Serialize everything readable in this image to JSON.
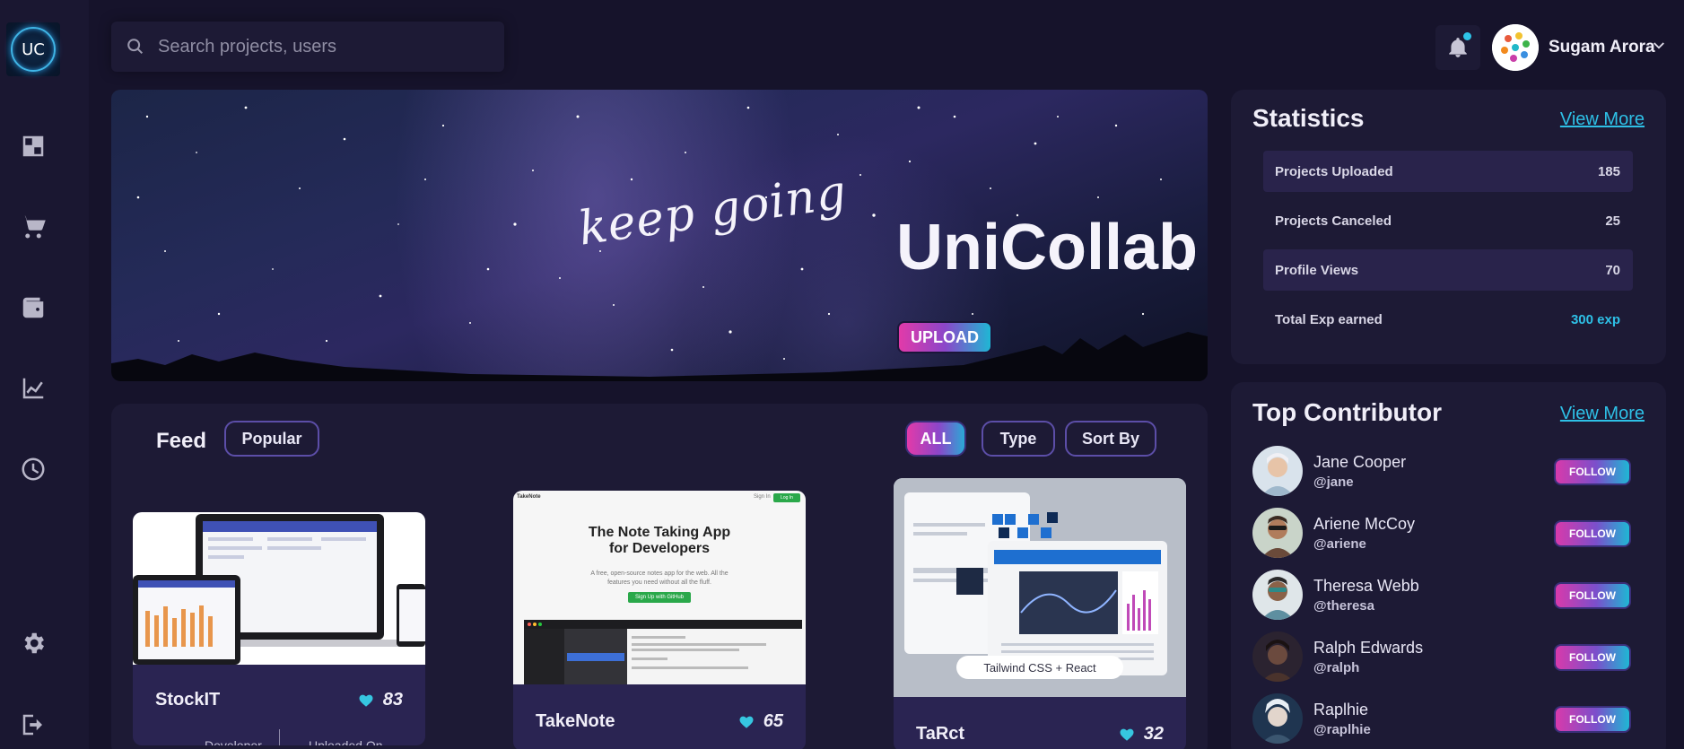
{
  "app": {
    "logo_text": "UC"
  },
  "sidebar": {
    "items": [
      {
        "icon": "dashboard-icon"
      },
      {
        "icon": "cart-icon"
      },
      {
        "icon": "wallet-icon"
      },
      {
        "icon": "chart-icon"
      },
      {
        "icon": "clock-icon"
      },
      {
        "icon": "gear-icon"
      },
      {
        "icon": "logout-icon"
      }
    ]
  },
  "search": {
    "placeholder": "Search projects, users",
    "value": ""
  },
  "user": {
    "name": "Sugam Arora"
  },
  "banner": {
    "tagline": "keep going",
    "brand": "UniCollab",
    "upload_label": "UPLOAD"
  },
  "feed": {
    "title": "Feed",
    "popular_label": "Popular",
    "filters": {
      "all": "ALL",
      "type": "Type",
      "sort": "Sort By"
    },
    "cards": [
      {
        "title": "StockIT",
        "likes": "83",
        "meta_left": "Developer",
        "meta_right": "Uploaded On"
      },
      {
        "title": "TakeNote",
        "likes": "65",
        "preview_brand": "TakeNote",
        "preview_heading_1": "The Note Taking App",
        "preview_heading_2": "for Developers",
        "preview_sub": "A free, open-source notes app for the web. All the features you need without all the fluff.",
        "preview_button": "Sign Up with GitHub",
        "preview_signin": "Sign In",
        "preview_login": "Log In"
      },
      {
        "title": "TaRct",
        "likes": "32",
        "preview_badge": "Tailwind CSS + React"
      }
    ]
  },
  "statistics": {
    "title": "Statistics",
    "view_more": "View More",
    "rows": [
      {
        "label": "Projects Uploaded",
        "value": "185"
      },
      {
        "label": "Projects Canceled",
        "value": "25"
      },
      {
        "label": "Profile Views",
        "value": "70"
      },
      {
        "label": "Total Exp earned",
        "value": "300 exp"
      }
    ]
  },
  "contributors": {
    "title": "Top Contributor",
    "view_more": "View More",
    "follow_label": "FOLLOW",
    "people": [
      {
        "name": "Jane Cooper",
        "handle": "@jane",
        "color": "#c9d6e3"
      },
      {
        "name": "Ariene McCoy",
        "handle": "@ariene",
        "color": "#7a5a48"
      },
      {
        "name": "Theresa Webb",
        "handle": "@theresa",
        "color": "#5e8fa0"
      },
      {
        "name": "Ralph Edwards",
        "handle": "@ralph",
        "color": "#6b4a3e"
      },
      {
        "name": "Raplhie",
        "handle": "@raplhie",
        "color": "#3b5670"
      }
    ]
  },
  "colors": {
    "background": "#16132b",
    "panel": "#1d1a35",
    "accent_cyan": "#2ec0e6",
    "accent_pink": "#e23aa9"
  }
}
